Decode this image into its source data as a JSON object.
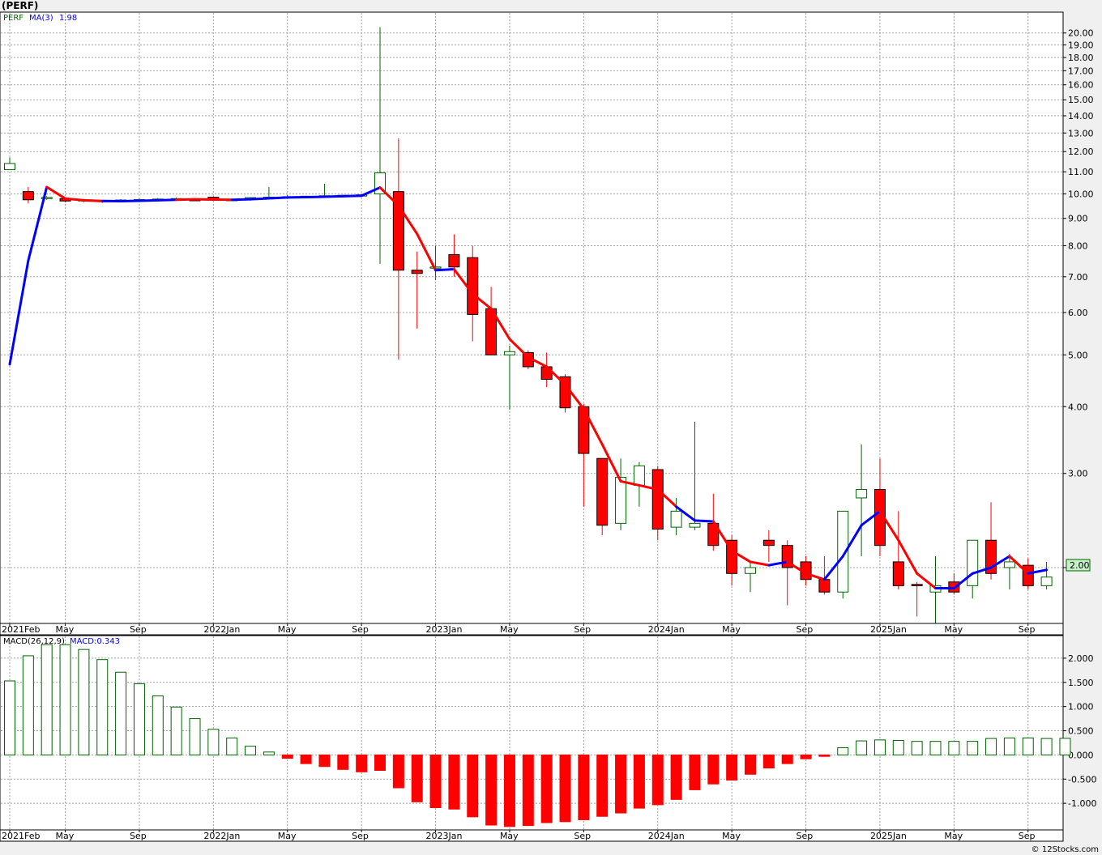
{
  "header": {
    "ticker": "(PERF)",
    "legend_symbol": "PERF",
    "legend_ma": "MA(3)",
    "legend_ma_value": "1.98",
    "last_price_label": "2.00"
  },
  "macd_panel": {
    "label": "MACD(26,12,9)",
    "value_label": "MACD:0.343"
  },
  "footer": {
    "credit": "© 12Stocks.com"
  },
  "colors": {
    "up": "#006400",
    "down": "#ff0000",
    "ma_up": "#0000ff",
    "ma_down": "#ff0000",
    "grid": "#a0a0a0",
    "panel_bg": "#ffffff"
  },
  "chart_data": [
    {
      "type": "candlestick",
      "scale": "log",
      "ylim": [
        1.6,
        21.5
      ],
      "y_ticks": [
        "2.00",
        "3.00",
        "4.00",
        "5.00",
        "6.00",
        "7.00",
        "8.00",
        "9.00",
        "10.00",
        "11.00",
        "12.00",
        "13.00",
        "14.00",
        "15.00",
        "16.00",
        "17.00",
        "18.00",
        "19.00",
        "20.00"
      ],
      "x_labels": [
        "2021Feb",
        "May",
        "Sep",
        "2022Jan",
        "May",
        "Sep",
        "2023Jan",
        "May",
        "Sep",
        "2024Jan",
        "May",
        "Sep",
        "2025Jan",
        "May",
        "Sep"
      ],
      "months": [
        "2021-02",
        "2021-03",
        "2021-04",
        "2021-05",
        "2021-06",
        "2021-07",
        "2021-08",
        "2021-09",
        "2021-10",
        "2021-11",
        "2021-12",
        "2022-01",
        "2022-02",
        "2022-03",
        "2022-04",
        "2022-05",
        "2022-06",
        "2022-07",
        "2022-08",
        "2022-09",
        "2022-10",
        "2022-11",
        "2022-12",
        "2023-01",
        "2023-02",
        "2023-03",
        "2023-04",
        "2023-05",
        "2023-06",
        "2023-07",
        "2023-08",
        "2023-09",
        "2023-10",
        "2023-11",
        "2023-12",
        "2024-01",
        "2024-02",
        "2024-03",
        "2024-04",
        "2024-05",
        "2024-06",
        "2024-07",
        "2024-08",
        "2024-09",
        "2024-10",
        "2024-11",
        "2024-12",
        "2025-01",
        "2025-02",
        "2025-03",
        "2025-04",
        "2025-05",
        "2025-06",
        "2025-07",
        "2025-08",
        "2025-09",
        "2025-10"
      ],
      "candles": [
        {
          "o": 11.1,
          "h": 11.7,
          "l": 11.1,
          "c": 11.4
        },
        {
          "o": 10.1,
          "h": 10.3,
          "l": 9.6,
          "c": 9.75
        },
        {
          "o": 9.8,
          "h": 9.9,
          "l": 9.75,
          "c": 9.85
        },
        {
          "o": 9.8,
          "h": 9.85,
          "l": 9.65,
          "c": 9.7
        },
        {
          "o": 9.72,
          "h": 9.78,
          "l": 9.65,
          "c": 9.75
        },
        {
          "o": 9.72,
          "h": 9.75,
          "l": 9.62,
          "c": 9.68
        },
        {
          "o": 9.7,
          "h": 9.78,
          "l": 9.66,
          "c": 9.74
        },
        {
          "o": 9.72,
          "h": 9.8,
          "l": 9.68,
          "c": 9.76
        },
        {
          "o": 9.74,
          "h": 9.82,
          "l": 9.7,
          "c": 9.78
        },
        {
          "o": 9.76,
          "h": 9.84,
          "l": 9.72,
          "c": 9.8
        },
        {
          "o": 9.76,
          "h": 9.82,
          "l": 9.72,
          "c": 9.74
        },
        {
          "o": 9.86,
          "h": 9.9,
          "l": 9.72,
          "c": 9.74
        },
        {
          "o": 9.74,
          "h": 9.8,
          "l": 9.7,
          "c": 9.76
        },
        {
          "o": 9.78,
          "h": 9.85,
          "l": 9.74,
          "c": 9.84
        },
        {
          "o": 9.84,
          "h": 10.3,
          "l": 9.8,
          "c": 9.86
        },
        {
          "o": 9.86,
          "h": 9.95,
          "l": 9.82,
          "c": 9.88
        },
        {
          "o": 9.88,
          "h": 9.92,
          "l": 9.84,
          "c": 9.9
        },
        {
          "o": 9.9,
          "h": 10.45,
          "l": 9.86,
          "c": 9.92
        },
        {
          "o": 9.92,
          "h": 9.96,
          "l": 9.88,
          "c": 9.94
        },
        {
          "o": 9.94,
          "h": 9.98,
          "l": 9.9,
          "c": 9.96
        },
        {
          "o": 10.0,
          "h": 20.5,
          "l": 7.4,
          "c": 10.95
        },
        {
          "o": 10.1,
          "h": 12.7,
          "l": 4.9,
          "c": 7.2
        },
        {
          "o": 7.2,
          "h": 7.8,
          "l": 5.6,
          "c": 7.1
        },
        {
          "o": 7.3,
          "h": 8.0,
          "l": 6.9,
          "c": 7.3
        },
        {
          "o": 7.7,
          "h": 8.4,
          "l": 7.0,
          "c": 7.3
        },
        {
          "o": 7.6,
          "h": 8.0,
          "l": 5.3,
          "c": 5.95
        },
        {
          "o": 6.1,
          "h": 6.7,
          "l": 5.0,
          "c": 5.0
        },
        {
          "o": 5.0,
          "h": 5.2,
          "l": 3.95,
          "c": 5.07
        },
        {
          "o": 5.05,
          "h": 5.1,
          "l": 4.7,
          "c": 4.75
        },
        {
          "o": 4.75,
          "h": 5.05,
          "l": 4.35,
          "c": 4.5
        },
        {
          "o": 4.55,
          "h": 4.6,
          "l": 3.9,
          "c": 3.98
        },
        {
          "o": 4.0,
          "h": 4.05,
          "l": 2.6,
          "c": 3.27
        },
        {
          "o": 3.2,
          "h": 3.2,
          "l": 2.3,
          "c": 2.4
        },
        {
          "o": 2.42,
          "h": 3.2,
          "l": 2.35,
          "c": 2.95
        },
        {
          "o": 2.85,
          "h": 3.15,
          "l": 2.6,
          "c": 3.1
        },
        {
          "o": 3.05,
          "h": 3.1,
          "l": 2.25,
          "c": 2.36
        },
        {
          "o": 2.38,
          "h": 2.7,
          "l": 2.3,
          "c": 2.55
        },
        {
          "o": 2.38,
          "h": 3.75,
          "l": 2.35,
          "c": 2.42
        },
        {
          "o": 2.42,
          "h": 2.75,
          "l": 2.15,
          "c": 2.2
        },
        {
          "o": 2.25,
          "h": 2.3,
          "l": 1.85,
          "c": 1.95
        },
        {
          "o": 1.95,
          "h": 2.05,
          "l": 1.8,
          "c": 2.0
        },
        {
          "o": 2.25,
          "h": 2.35,
          "l": 2.05,
          "c": 2.2
        },
        {
          "o": 2.2,
          "h": 2.25,
          "l": 1.7,
          "c": 2.0
        },
        {
          "o": 2.05,
          "h": 2.1,
          "l": 1.85,
          "c": 1.9
        },
        {
          "o": 1.9,
          "h": 2.1,
          "l": 1.78,
          "c": 1.8
        },
        {
          "o": 1.8,
          "h": 2.5,
          "l": 1.75,
          "c": 2.55
        },
        {
          "o": 2.7,
          "h": 3.4,
          "l": 2.1,
          "c": 2.8
        },
        {
          "o": 2.8,
          "h": 3.2,
          "l": 2.1,
          "c": 2.2
        },
        {
          "o": 2.05,
          "h": 2.55,
          "l": 1.82,
          "c": 1.85
        },
        {
          "o": 1.86,
          "h": 1.88,
          "l": 1.62,
          "c": 1.85
        },
        {
          "o": 1.8,
          "h": 2.1,
          "l": 1.55,
          "c": 1.85
        },
        {
          "o": 1.88,
          "h": 1.95,
          "l": 1.78,
          "c": 1.8
        },
        {
          "o": 1.85,
          "h": 2.25,
          "l": 1.75,
          "c": 2.25
        },
        {
          "o": 2.25,
          "h": 2.65,
          "l": 1.9,
          "c": 1.95
        },
        {
          "o": 2.0,
          "h": 2.12,
          "l": 1.82,
          "c": 2.05
        },
        {
          "o": 2.02,
          "h": 2.08,
          "l": 1.82,
          "c": 1.85
        },
        {
          "o": 1.85,
          "h": 2.05,
          "l": 1.82,
          "c": 1.92
        }
      ],
      "ma3": [
        4.8,
        7.5,
        10.3,
        9.8,
        9.73,
        9.7,
        9.69,
        9.71,
        9.73,
        9.75,
        9.77,
        9.76,
        9.75,
        9.77,
        9.81,
        9.85,
        9.86,
        9.88,
        9.9,
        9.92,
        10.28,
        9.51,
        8.42,
        7.2,
        7.23,
        6.5,
        6.1,
        5.35,
        4.95,
        4.75,
        4.4,
        3.96,
        3.4,
        2.9,
        2.85,
        2.8,
        2.6,
        2.45,
        2.44,
        2.15,
        2.05,
        2.02,
        2.05,
        1.95,
        1.9,
        2.1,
        2.4,
        2.55,
        2.25,
        1.95,
        1.83,
        1.83,
        1.95,
        2.0,
        2.1,
        1.95,
        1.98
      ],
      "ma3_color": [
        "up",
        "up",
        "up",
        "down",
        "down",
        "down",
        "up",
        "up",
        "up",
        "up",
        "down",
        "down",
        "down",
        "up",
        "up",
        "up",
        "up",
        "up",
        "up",
        "up",
        "up",
        "down",
        "down",
        "down",
        "up",
        "down",
        "down",
        "down",
        "down",
        "down",
        "down",
        "down",
        "down",
        "down",
        "down",
        "down",
        "down",
        "up",
        "up",
        "down",
        "down",
        "down",
        "up",
        "down",
        "down",
        "up",
        "up",
        "up",
        "down",
        "down",
        "down",
        "up",
        "up",
        "up",
        "up",
        "down",
        "up"
      ]
    },
    {
      "type": "bar",
      "name": "MACD(26,12,9)",
      "ylim": [
        -1.5,
        2.35
      ],
      "y_ticks": [
        "-1.000",
        "-0.500",
        "0.000",
        "0.500",
        "1.000",
        "1.500",
        "2.000"
      ],
      "x_labels": [
        "2021Feb",
        "May",
        "Sep",
        "2022Jan",
        "May",
        "Sep",
        "2023Jan",
        "May",
        "Sep",
        "2024Jan",
        "May",
        "Sep",
        "2025Jan",
        "May",
        "Sep"
      ],
      "values": [
        1.53,
        2.05,
        2.28,
        2.28,
        2.18,
        1.97,
        1.71,
        1.47,
        1.22,
        0.99,
        0.75,
        0.53,
        0.35,
        0.18,
        0.06,
        -0.07,
        -0.18,
        -0.24,
        -0.3,
        -0.35,
        -0.32,
        -0.68,
        -0.97,
        -1.09,
        -1.12,
        -1.28,
        -1.45,
        -1.48,
        -1.46,
        -1.4,
        -1.38,
        -1.34,
        -1.27,
        -1.2,
        -1.1,
        -1.03,
        -0.92,
        -0.72,
        -0.6,
        -0.52,
        -0.4,
        -0.27,
        -0.18,
        -0.08,
        -0.03,
        0.15,
        0.29,
        0.31,
        0.3,
        0.28,
        0.28,
        0.28,
        0.28,
        0.34,
        0.35,
        0.35,
        0.34,
        0.343
      ]
    }
  ]
}
